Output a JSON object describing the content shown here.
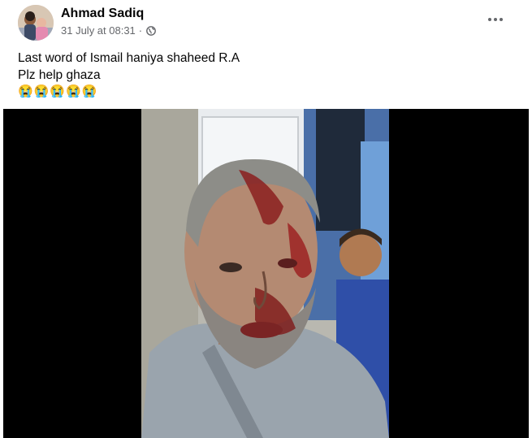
{
  "post": {
    "author": {
      "name": "Ahmad Sadiq",
      "avatar_icon": "profile-photo"
    },
    "timestamp": "31 July at 08:31",
    "separator": "·",
    "audience_icon": "globe-icon",
    "more_icon": "more-options-icon",
    "text_lines": [
      "Last word of Ismail haniya shaheed R.A",
      "Plz help ghaza"
    ],
    "emojis": [
      "😭",
      "😭",
      "😭",
      "😭",
      "😭"
    ],
    "media": {
      "type": "video"
    }
  },
  "colors": {
    "name": "#050505",
    "meta": "#65676b",
    "video_bg": "#000000"
  }
}
